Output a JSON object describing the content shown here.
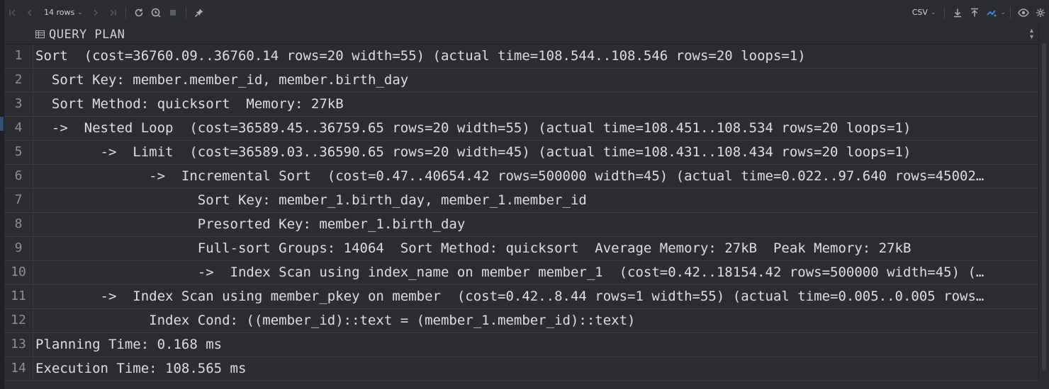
{
  "toolbar": {
    "rows_label": "14 rows",
    "export_format": "CSV",
    "icons": [
      "first-page-icon",
      "prev-page-icon",
      "next-page-icon",
      "last-page-icon",
      "refresh-icon",
      "history-icon",
      "stop-icon",
      "pin-icon",
      "download-icon",
      "upload-icon",
      "compare-icon",
      "view-icon",
      "settings-icon"
    ]
  },
  "column": {
    "title": "QUERY PLAN"
  },
  "rows": [
    {
      "n": "1",
      "text": "Sort  (cost=36760.09..36760.14 rows=20 width=55) (actual time=108.544..108.546 rows=20 loops=1)"
    },
    {
      "n": "2",
      "text": "  Sort Key: member.member_id, member.birth_day"
    },
    {
      "n": "3",
      "text": "  Sort Method: quicksort  Memory: 27kB"
    },
    {
      "n": "4",
      "text": "  ->  Nested Loop  (cost=36589.45..36759.65 rows=20 width=55) (actual time=108.451..108.534 rows=20 loops=1)"
    },
    {
      "n": "5",
      "text": "        ->  Limit  (cost=36589.03..36590.65 rows=20 width=45) (actual time=108.431..108.434 rows=20 loops=1)"
    },
    {
      "n": "6",
      "text": "              ->  Incremental Sort  (cost=0.47..40654.42 rows=500000 width=45) (actual time=0.022..97.640 rows=45002…"
    },
    {
      "n": "7",
      "text": "                    Sort Key: member_1.birth_day, member_1.member_id"
    },
    {
      "n": "8",
      "text": "                    Presorted Key: member_1.birth_day"
    },
    {
      "n": "9",
      "text": "                    Full-sort Groups: 14064  Sort Method: quicksort  Average Memory: 27kB  Peak Memory: 27kB"
    },
    {
      "n": "10",
      "text": "                    ->  Index Scan using index_name on member member_1  (cost=0.42..18154.42 rows=500000 width=45) (…"
    },
    {
      "n": "11",
      "text": "        ->  Index Scan using member_pkey on member  (cost=0.42..8.44 rows=1 width=55) (actual time=0.005..0.005 rows…"
    },
    {
      "n": "12",
      "text": "              Index Cond: ((member_id)::text = (member_1.member_id)::text)"
    },
    {
      "n": "13",
      "text": "Planning Time: 0.168 ms"
    },
    {
      "n": "14",
      "text": "Execution Time: 108.565 ms"
    }
  ]
}
